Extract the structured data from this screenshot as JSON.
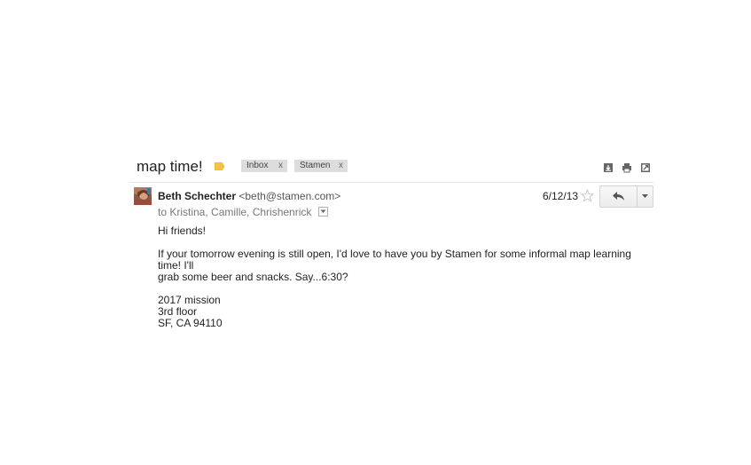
{
  "thread": {
    "subject": "map time!",
    "importance_icon": "importance-marker-icon",
    "importance_color": "#f5c242",
    "labels": [
      {
        "name": "Inbox",
        "remove": "x"
      },
      {
        "name": "Stamen",
        "remove": "x"
      }
    ],
    "toolbar_icons": [
      "download-icon",
      "print-icon",
      "new-window-icon"
    ]
  },
  "message": {
    "sender_name": "Beth Schechter",
    "sender_email": "<beth@stamen.com>",
    "recipients": "to Kristina, Camille, Chrishenrick",
    "date": "6/12/13",
    "star_icon": "star-icon",
    "reply_icon": "reply-icon",
    "more_icon": "chevron-down-icon",
    "body": {
      "greeting": "Hi friends!",
      "paragraph_line1": "If your tomorrow evening is still open, I'd love to have you by Stamen for some informal map learning time! I'll",
      "paragraph_line2": "grab some beer and snacks. Say...6:30?",
      "address_line1": "2017 mission",
      "address_line2": "3rd floor",
      "address_line3": "SF, CA 94110"
    }
  }
}
